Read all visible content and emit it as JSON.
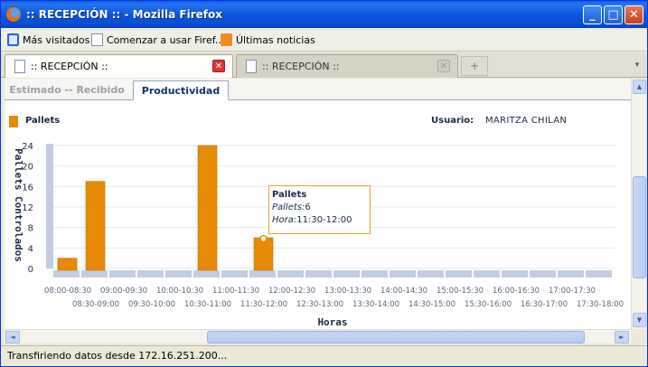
{
  "window": {
    "title": ":: RECEPCIÓN :: - Mozilla Firefox",
    "min_glyph": "_",
    "max_glyph": "□",
    "close_glyph": "✕"
  },
  "bookmarks": [
    {
      "label": "Más visitados",
      "icon": "search-icon"
    },
    {
      "label": "Comenzar a usar Firef...",
      "icon": "page-icon"
    },
    {
      "label": "Últimas noticias",
      "icon": "rss-icon"
    }
  ],
  "tabs": [
    {
      "label": ":: RECEPCIÓN ::",
      "active": true
    },
    {
      "label": ":: RECEPCIÓN ::",
      "active": false
    }
  ],
  "tab_close_glyph": "✕",
  "newtab_glyph": "+",
  "tab_scroll_glyph": "▾",
  "app_tabs": [
    {
      "label": "Estimado -- Recibido",
      "active": false
    },
    {
      "label": "Productividad",
      "active": true
    }
  ],
  "legend": {
    "label": "Pallets",
    "color": "#e88a06"
  },
  "user": {
    "label": "Usuario:",
    "value": "MARITZA CHILAN"
  },
  "tooltip": {
    "title": "Pallets",
    "value_label": "Pallets:",
    "value": "6",
    "hour_label": "Hora:",
    "hour": "11:30-12:00"
  },
  "chart_data": {
    "type": "bar",
    "title": "",
    "ylabel": "Pallets Controlados",
    "xlabel": "Horas",
    "ylim": [
      0,
      24
    ],
    "yticks": [
      0,
      4,
      8,
      12,
      16,
      20,
      24
    ],
    "bar_color": "#e88a06",
    "base_color": "#c0cedd",
    "categories": [
      "08:00-08:30",
      "08:30-09:00",
      "09:00-09:30",
      "09:30-10:00",
      "10:00-10:30",
      "10:30-11:00",
      "11:00-11:30",
      "11:30-12:00",
      "12:00-12:30",
      "12:30-13:00",
      "13:00-13:30",
      "13:30-14:00",
      "14:00-14:30",
      "14:30-15:00",
      "15:00-15:30",
      "15:30-16:00",
      "16:00-16:30",
      "16:30-17:00",
      "17:00-17:30",
      "17:30-18:00"
    ],
    "series": [
      {
        "name": "Pallets",
        "values": [
          2,
          17,
          0,
          0,
          0,
          24,
          0,
          6,
          0,
          0,
          0,
          0,
          0,
          0,
          0,
          0,
          0,
          0,
          0,
          0
        ]
      }
    ],
    "highlighted_index": 7,
    "grid": true
  },
  "status": {
    "text": "Transfiriendo datos desde 172.16.251.200..."
  },
  "scroll_glyphs": {
    "up": "▲",
    "down": "▼",
    "left": "◄",
    "right": "►",
    "grip": "≡"
  }
}
